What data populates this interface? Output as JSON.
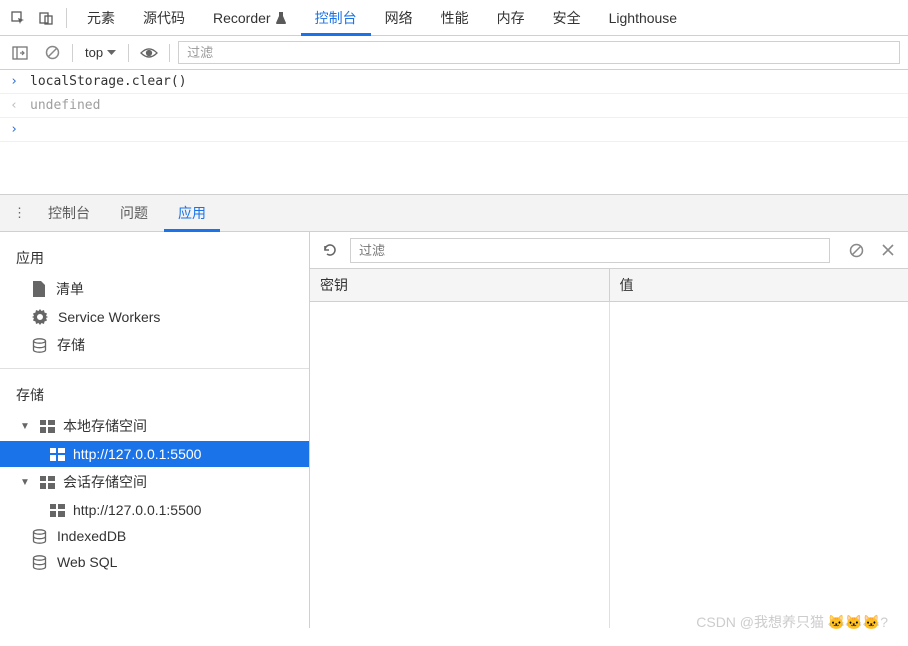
{
  "topTabs": {
    "elements": "元素",
    "sources": "源代码",
    "recorder": "Recorder",
    "console": "控制台",
    "network": "网络",
    "performance": "性能",
    "memory": "内存",
    "security": "安全",
    "lighthouse": "Lighthouse"
  },
  "consoleToolbar": {
    "context": "top",
    "filterPlaceholder": "过滤"
  },
  "consoleLines": {
    "input": "localStorage.clear()",
    "output": "undefined"
  },
  "drawerTabs": {
    "console": "控制台",
    "issues": "问题",
    "application": "应用"
  },
  "sidebar": {
    "appSection": "应用",
    "manifest": "清单",
    "serviceWorkers": "Service Workers",
    "storage": "存储",
    "storageSection": "存储",
    "localStorage": "本地存储空间",
    "localStorageUrl": "http://127.0.0.1:5500",
    "sessionStorage": "会话存储空间",
    "sessionStorageUrl": "http://127.0.0.1:5500",
    "indexedDB": "IndexedDB",
    "webSQL": "Web SQL"
  },
  "content": {
    "filterPlaceholder": "过滤",
    "keyHeader": "密钥",
    "valueHeader": "值"
  },
  "watermark": "CSDN @我想养只猫 🐱🐱🐱?"
}
